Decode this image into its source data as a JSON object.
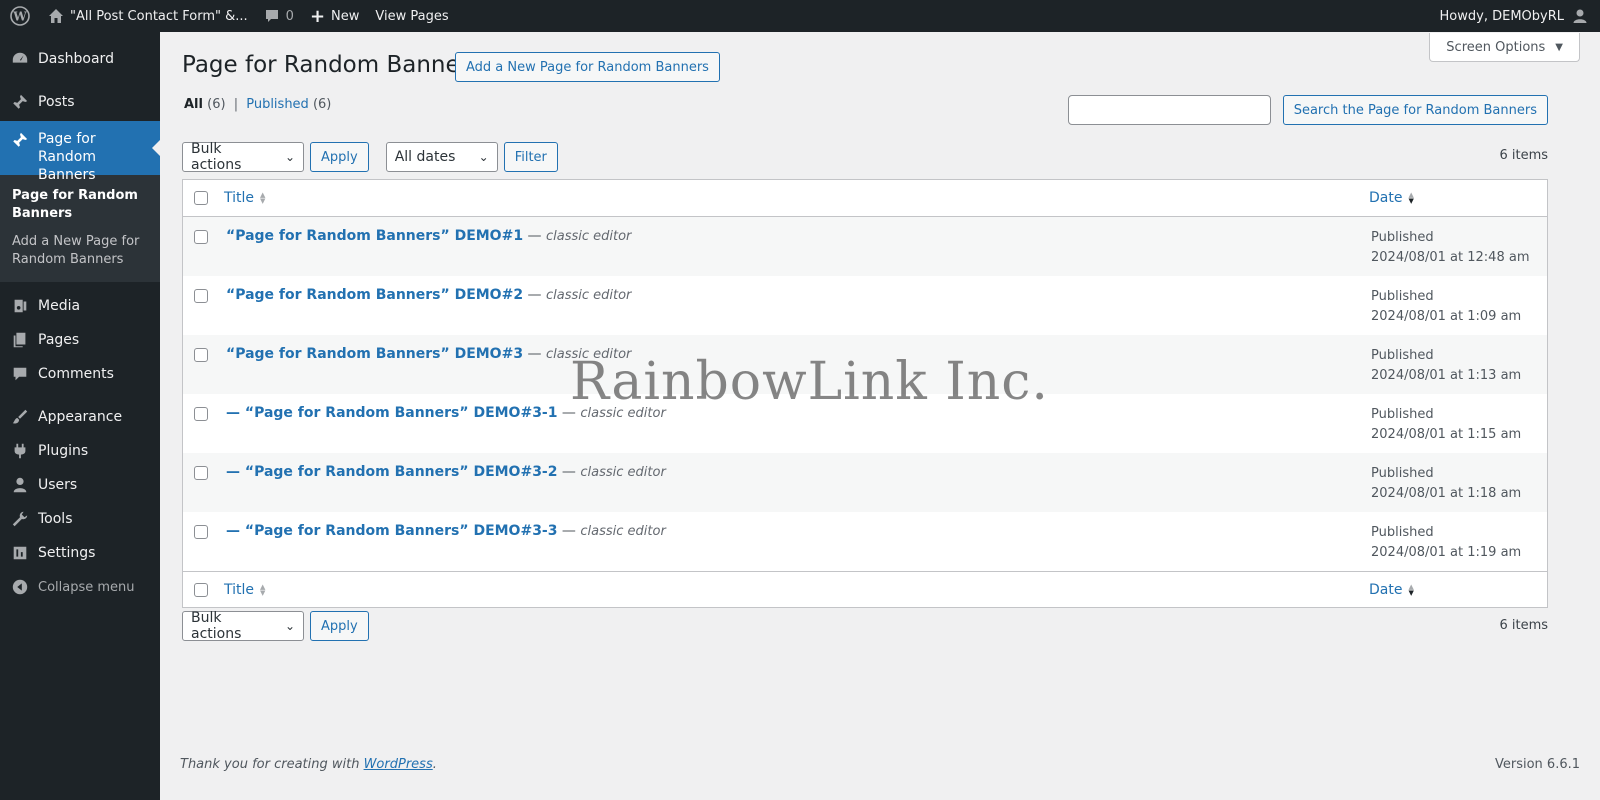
{
  "adminbar": {
    "site_name": "\"All Post Contact Form\" &...",
    "comments_count": "0",
    "new_label": "New",
    "view_pages_label": "View Pages",
    "howdy": "Howdy, DEMObyRL"
  },
  "sidebar": {
    "items": [
      {
        "label": "Dashboard",
        "icon": "dashboard-icon"
      },
      {
        "label": "Posts",
        "icon": "pin-icon"
      },
      {
        "label": "Page for Random Banners",
        "icon": "pin-icon"
      },
      {
        "label": "Media",
        "icon": "media-icon"
      },
      {
        "label": "Pages",
        "icon": "pages-icon"
      },
      {
        "label": "Comments",
        "icon": "comment-icon"
      },
      {
        "label": "Appearance",
        "icon": "brush-icon"
      },
      {
        "label": "Plugins",
        "icon": "plug-icon"
      },
      {
        "label": "Users",
        "icon": "user-icon"
      },
      {
        "label": "Tools",
        "icon": "wrench-icon"
      },
      {
        "label": "Settings",
        "icon": "settings-icon"
      }
    ],
    "submenu": [
      "Page for Random Banners",
      "Add a New Page for Random Banners"
    ],
    "collapse_label": "Collapse menu"
  },
  "header": {
    "title": "Page for Random Banners",
    "add_new_label": "Add a New Page for Random Banners",
    "screen_options_label": "Screen Options"
  },
  "filters": {
    "all_label": "All",
    "all_count": "(6)",
    "published_label": "Published",
    "published_count": "(6)",
    "separator": "|"
  },
  "search": {
    "value": "",
    "button_label": "Search the Page for Random Banners"
  },
  "tablenav": {
    "bulk_actions": "Bulk actions",
    "apply_label": "Apply",
    "all_dates": "All dates",
    "filter_label": "Filter",
    "items_count": "6 items"
  },
  "table": {
    "columns": {
      "title": "Title",
      "date": "Date"
    },
    "rows": [
      {
        "prefix": "",
        "title": "“Page for Random Banners” DEMO#1",
        "state": "classic editor",
        "status": "Published",
        "date": "2024/08/01 at 12:48 am"
      },
      {
        "prefix": "",
        "title": "“Page for Random Banners” DEMO#2",
        "state": "classic editor",
        "status": "Published",
        "date": "2024/08/01 at 1:09 am"
      },
      {
        "prefix": "",
        "title": "“Page for Random Banners” DEMO#3",
        "state": "classic editor",
        "status": "Published",
        "date": "2024/08/01 at 1:13 am"
      },
      {
        "prefix": "— ",
        "title": "“Page for Random Banners” DEMO#3-1",
        "state": "classic editor",
        "status": "Published",
        "date": "2024/08/01 at 1:15 am"
      },
      {
        "prefix": "— ",
        "title": "“Page for Random Banners” DEMO#3-2",
        "state": "classic editor",
        "status": "Published",
        "date": "2024/08/01 at 1:18 am"
      },
      {
        "prefix": "— ",
        "title": "“Page for Random Banners” DEMO#3-3",
        "state": "classic editor",
        "status": "Published",
        "date": "2024/08/01 at 1:19 am"
      }
    ],
    "title_separator": " — "
  },
  "watermark": "RainbowLink Inc.",
  "footer": {
    "thanks_prefix": "Thank you for creating with ",
    "thanks_link": "WordPress",
    "thanks_suffix": ".",
    "version": "Version 6.6.1"
  },
  "colors": {
    "accent": "#2271b1",
    "adminbar": "#1d2327",
    "background": "#f0f0f1"
  }
}
